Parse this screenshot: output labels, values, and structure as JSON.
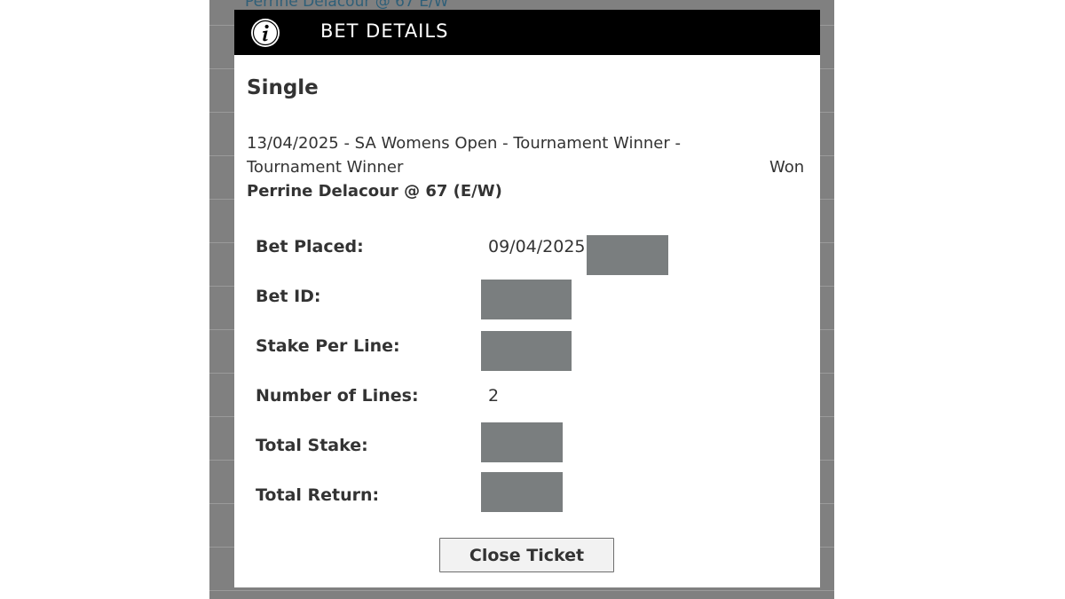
{
  "background": {
    "partial_text": "Perrine Delacour @ 67 E/W"
  },
  "modal": {
    "title": "BET DETAILS",
    "header_icon": "info-icon",
    "bet_type": "Single",
    "event_description": "13/04/2025 - SA Womens Open - Tournament Winner - Tournament Winner",
    "result": "Won",
    "selection": "Perrine Delacour @ 67 (E/W)",
    "details": [
      {
        "label": "Bet Placed:",
        "value": "09/04/2025",
        "redacted": true
      },
      {
        "label": "Bet ID:",
        "value": "",
        "redacted": true
      },
      {
        "label": "Stake Per Line:",
        "value": "",
        "redacted": true
      },
      {
        "label": "Number of Lines:",
        "value": "2",
        "redacted": false
      },
      {
        "label": "Total Stake:",
        "value": "",
        "redacted": true
      },
      {
        "label": "Total Return:",
        "value": "",
        "redacted": true
      }
    ],
    "close_label": "Close Ticket"
  },
  "colors": {
    "header_bg": "#000000",
    "overlay": "#808080",
    "redaction": "#7a7e7f"
  }
}
